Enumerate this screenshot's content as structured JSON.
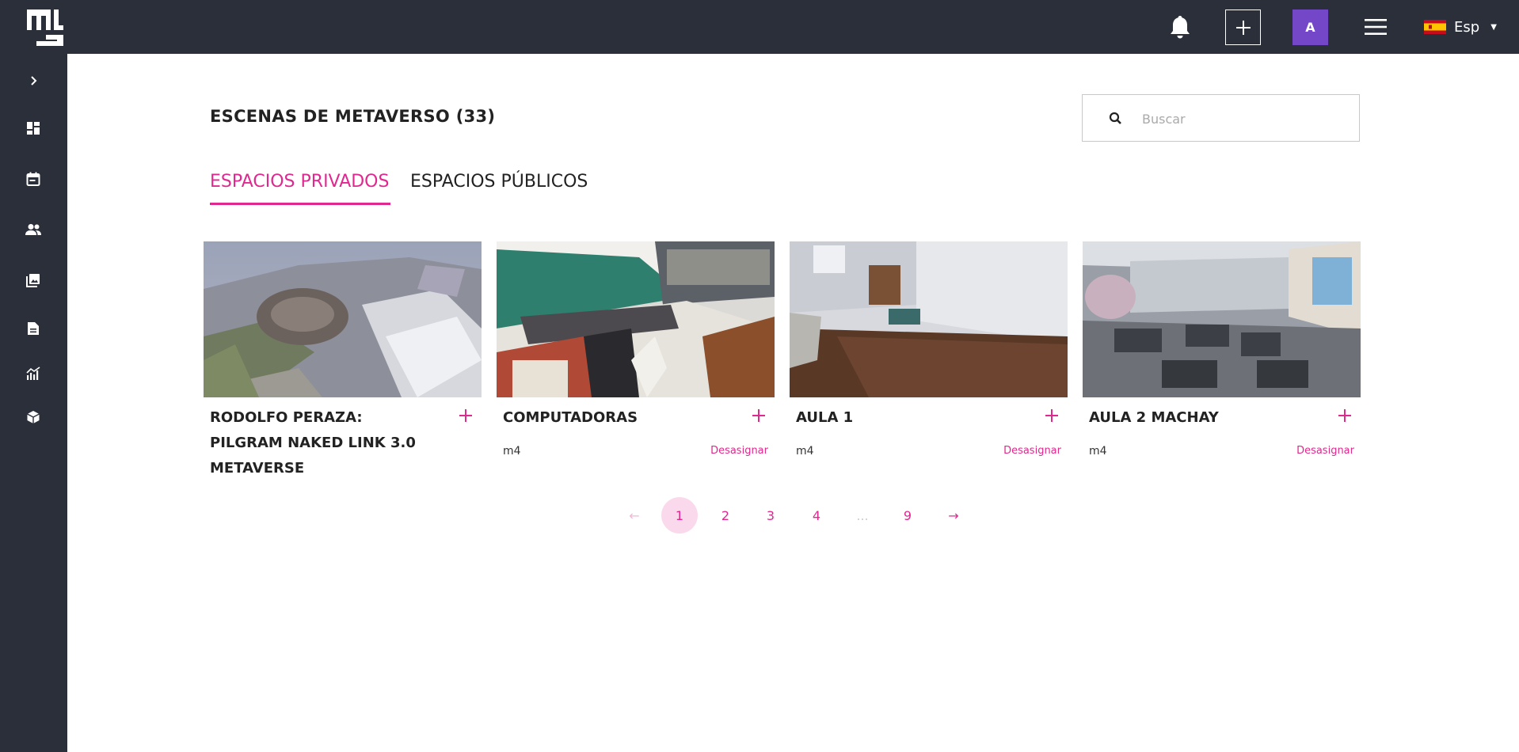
{
  "header": {
    "logo_icon": "mu-logo",
    "notifications_icon": "bell-icon",
    "add_icon": "plus-icon",
    "avatar_initial": "A",
    "menu_icon": "hamburger-icon",
    "language": {
      "label": "Esp",
      "flag": "spain-flag-icon"
    }
  },
  "sidebar": {
    "expand_icon": "chevron-right-icon",
    "items": [
      {
        "icon": "dashboard-icon"
      },
      {
        "icon": "calendar-icon"
      },
      {
        "icon": "people-icon"
      },
      {
        "icon": "gallery-icon"
      },
      {
        "icon": "document-icon"
      },
      {
        "icon": "analytics-icon"
      },
      {
        "icon": "cube-icon"
      }
    ]
  },
  "main": {
    "title": "ESCENAS DE METAVERSO (33)",
    "search": {
      "placeholder": "Buscar",
      "value": ""
    },
    "tabs": [
      {
        "label": "ESPACIOS PRIVADOS",
        "active": true
      },
      {
        "label": "ESPACIOS PÚBLICOS",
        "active": false
      }
    ],
    "cards": [
      {
        "title": "RODOLFO PERAZA: PILGRAM NAKED LINK 3.0 METAVERSE",
        "tag": "",
        "action": ""
      },
      {
        "title": "COMPUTADORAS",
        "tag": "m4",
        "action": "Desasignar"
      },
      {
        "title": "AULA 1",
        "tag": "m4",
        "action": "Desasignar"
      },
      {
        "title": "AULA 2 MACHAY",
        "tag": "m4",
        "action": "Desasignar"
      }
    ],
    "pagination": {
      "prev": "←",
      "pages": [
        "1",
        "2",
        "3",
        "4",
        "...",
        "9"
      ],
      "current": "1",
      "next": "→"
    }
  },
  "colors": {
    "accent": "#e0298f",
    "topbar": "#2a2f3a",
    "avatar": "#7446c8"
  }
}
